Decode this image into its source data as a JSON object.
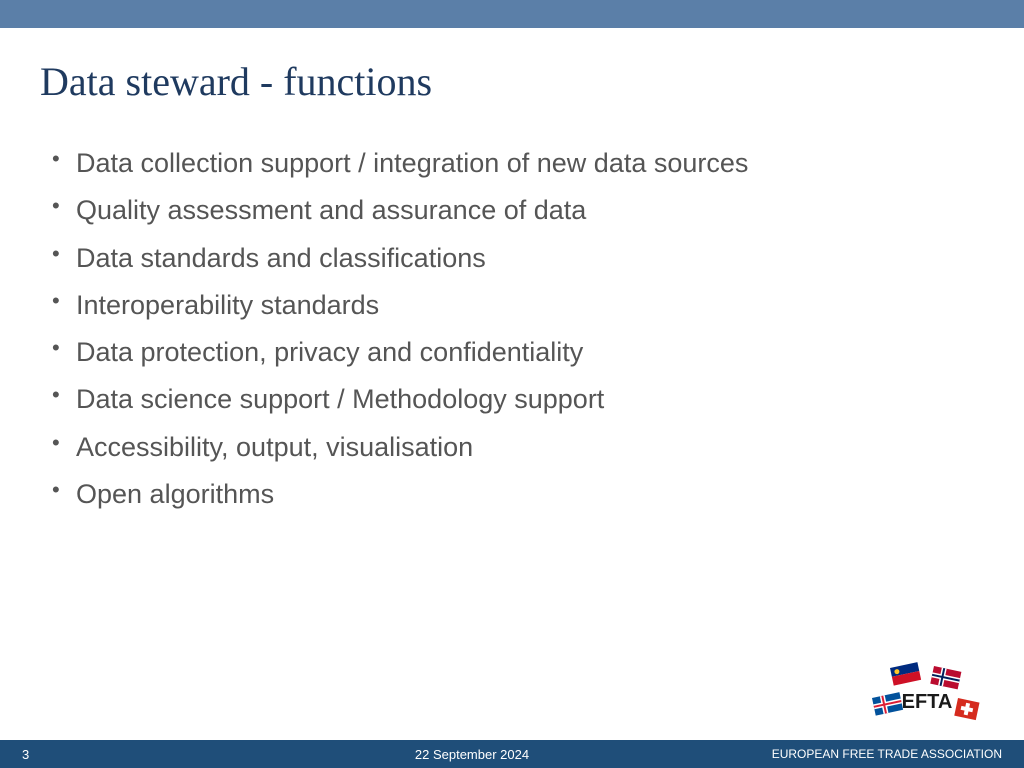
{
  "title": "Data steward - functions",
  "bullets": [
    "Data collection support / integration of new data sources",
    "Quality assessment and assurance of data",
    "Data standards and classifications",
    "Interoperability standards",
    "Data protection, privacy and confidentiality",
    "Data science support / Methodology support",
    "Accessibility, output, visualisation",
    "Open algorithms"
  ],
  "footer": {
    "page_number": "3",
    "date": "22 September 2024",
    "org_name": "EUROPEAN FREE TRADE ASSOCIATION"
  },
  "logo": {
    "text": "EFTA"
  }
}
